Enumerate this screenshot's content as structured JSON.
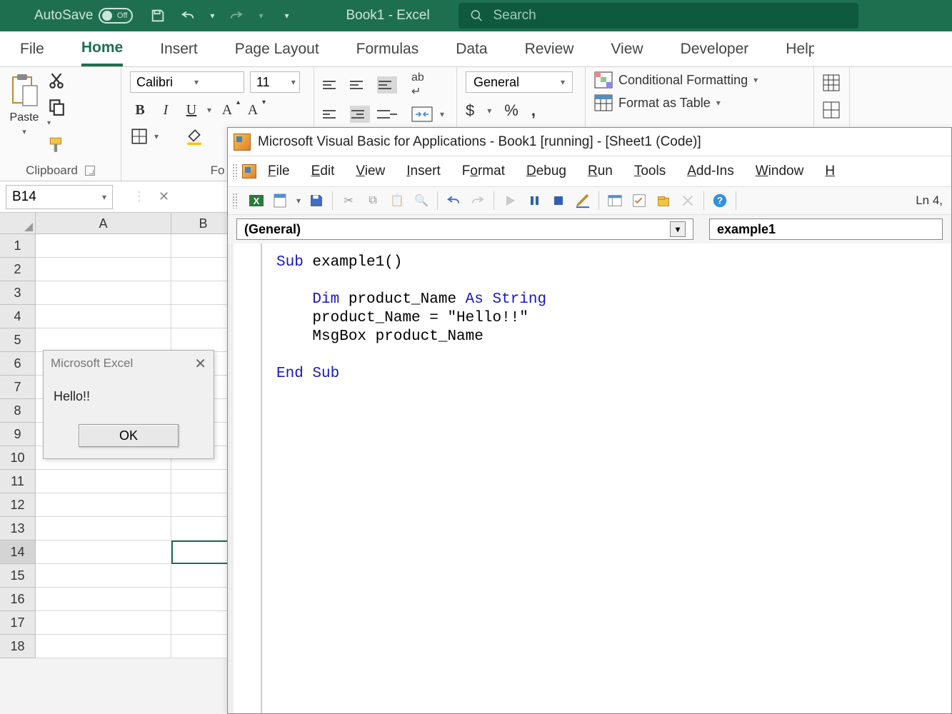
{
  "titlebar": {
    "autosave_label": "AutoSave",
    "autosave_state": "Off",
    "book_title": "Book1 - Excel",
    "search_placeholder": "Search"
  },
  "tabs": {
    "file": "File",
    "home": "Home",
    "insert": "Insert",
    "page_layout": "Page Layout",
    "formulas": "Formulas",
    "data": "Data",
    "review": "Review",
    "view": "View",
    "developer": "Developer",
    "help": "Help"
  },
  "ribbon": {
    "clipboard": {
      "paste": "Paste",
      "label": "Clipboard"
    },
    "font": {
      "name": "Calibri",
      "size": "11",
      "label": "Font"
    },
    "number": {
      "format": "General"
    },
    "styles": {
      "cond": "Conditional Formatting",
      "table": "Format as Table"
    }
  },
  "formula": {
    "namebox": "B14"
  },
  "grid": {
    "cols": [
      "A",
      "B"
    ],
    "rows": [
      "1",
      "2",
      "3",
      "4",
      "5",
      "6",
      "7",
      "8",
      "9",
      "10",
      "11",
      "12",
      "13",
      "14",
      "15",
      "16",
      "17",
      "18"
    ],
    "active_row": "14",
    "selected": "B14"
  },
  "msgbox": {
    "title": "Microsoft Excel",
    "text": "Hello!!",
    "ok": "OK"
  },
  "vba": {
    "title": "Microsoft Visual Basic for Applications - Book1 [running] - [Sheet1 (Code)]",
    "menus": {
      "file": "File",
      "edit": "Edit",
      "view": "View",
      "insert": "Insert",
      "format": "Format",
      "debug": "Debug",
      "run": "Run",
      "tools": "Tools",
      "addins": "Add-Ins",
      "window": "Window",
      "help": "Help"
    },
    "position": "Ln 4,",
    "combo_left": "(General)",
    "combo_right": "example1",
    "code": {
      "l1a": "Sub",
      "l1b": " example1()",
      "l2a": "Dim",
      "l2b": " product_Name ",
      "l2c": "As String",
      "l3": "product_Name = \"Hello!!\"",
      "l4": "MsgBox product_Name",
      "l5": "End Sub"
    }
  }
}
